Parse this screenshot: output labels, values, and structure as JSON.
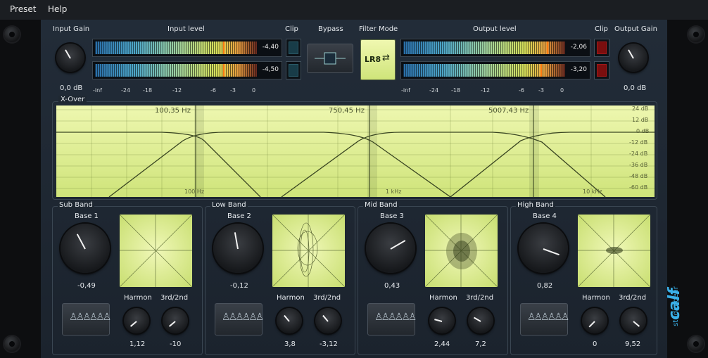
{
  "menu": {
    "preset": "Preset",
    "help": "Help"
  },
  "header": {
    "input_gain_label": "Input Gain",
    "input_level_label": "Input level",
    "clip_label": "Clip",
    "bypass_label": "Bypass",
    "filter_mode_label": "Filter Mode",
    "output_level_label": "Output level",
    "output_clip_label": "Clip",
    "output_gain_label": "Output Gain",
    "input_gain_value": "0,0 dB",
    "output_gain_value": "0,0 dB",
    "input_meter": [
      {
        "value": "-4,40"
      },
      {
        "value": "-4,50"
      }
    ],
    "output_meter": [
      {
        "value": "-2,06"
      },
      {
        "value": "-3,20"
      }
    ],
    "meter_scale": [
      "-inf",
      "-24",
      "-18",
      "-12",
      "-6",
      "-3",
      "0"
    ],
    "filter_mode": "LR8"
  },
  "xover": {
    "label": "X-Over",
    "freqs": [
      "100,35 Hz",
      "750,45 Hz",
      "5007,43 Hz"
    ],
    "db_labels": [
      "24 dB",
      "12 dB",
      "0 dB",
      "-12 dB",
      "-24 dB",
      "-36 dB",
      "-48 dB",
      "-60 dB"
    ],
    "freq_labels": [
      "100 Hz",
      "1 kHz",
      "10 kHz"
    ]
  },
  "bands": [
    {
      "title": "Sub Band",
      "base_label": "Base 1",
      "base_value": "-0,49",
      "harmon_label": "Harmon",
      "harmon_value": "1,12",
      "ratio_label": "3rd/2nd",
      "ratio_value": "-10"
    },
    {
      "title": "Low Band",
      "base_label": "Base 2",
      "base_value": "-0,12",
      "harmon_label": "Harmon",
      "harmon_value": "3,8",
      "ratio_label": "3rd/2nd",
      "ratio_value": "-3,12"
    },
    {
      "title": "Mid Band",
      "base_label": "Base 3",
      "base_value": "0,43",
      "harmon_label": "Harmon",
      "harmon_value": "2,44",
      "ratio_label": "3rd/2nd",
      "ratio_value": "7,2"
    },
    {
      "title": "High Band",
      "base_label": "Base 4",
      "base_value": "0,82",
      "harmon_label": "Harmon",
      "harmon_value": "0",
      "ratio_label": "3rd/2nd",
      "ratio_value": "9,52"
    }
  ],
  "branding": {
    "logo": "calf",
    "sub": "studio gear"
  },
  "colors": {
    "accent": "#3ab0e8",
    "screen": "#dcec90",
    "clip_red": "#9a1010",
    "meter_peak": "#ff7a10"
  }
}
